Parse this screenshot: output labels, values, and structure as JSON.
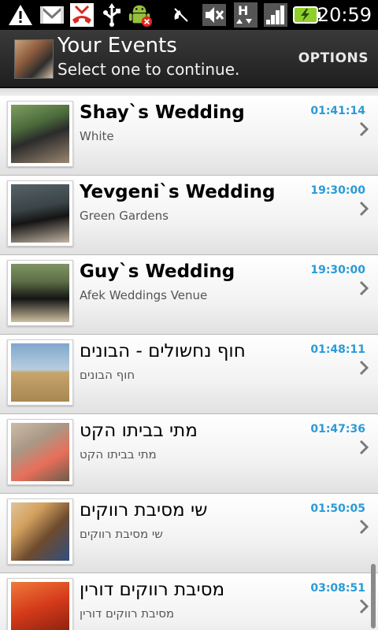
{
  "status_bar": {
    "time": "20:59",
    "icons": [
      "warning-icon",
      "gmail-icon",
      "missed-call-icon",
      "usb-icon",
      "android-debug-icon",
      "mute-icon",
      "speaker-mute-icon",
      "hspa-data-icon",
      "signal-icon",
      "battery-charging-icon"
    ]
  },
  "header": {
    "title": "Your Events",
    "subtitle": "Select one to continue.",
    "options_label": "OPTIONS"
  },
  "events": [
    {
      "title": "Shay`s Wedding",
      "location": "White",
      "time": "01:41:14",
      "bold": true,
      "thumb_colors": [
        "#6f8f5a",
        "#2a2a2a",
        "#9c8a72"
      ]
    },
    {
      "title": "Yevgeni`s Wedding",
      "location": "Green Gardens",
      "time": "19:30:00",
      "bold": true,
      "thumb_colors": [
        "#5e6b6e",
        "#1a1a1a",
        "#b7a89a"
      ]
    },
    {
      "title": "Guy`s Wedding",
      "location": "Afek Weddings Venue",
      "time": "19:30:00",
      "bold": true,
      "thumb_colors": [
        "#7b8e5e",
        "#121212",
        "#c7b79a"
      ]
    },
    {
      "title": "חוף נחשולים - הבונים",
      "location": "חוף הבונים",
      "time": "01:48:11",
      "bold": false,
      "thumb_colors": [
        "#8fb2cf",
        "#c7a56b",
        "#a88752"
      ]
    },
    {
      "title": "מתי בביתו הקט",
      "location": "מתי בביתו הקט",
      "time": "01:47:36",
      "bold": false,
      "thumb_colors": [
        "#c9b8a3",
        "#e86f5a",
        "#6b5c4c"
      ]
    },
    {
      "title": "שי מסיבת רווקים",
      "location": "שי מסיבת רווקים",
      "time": "01:50:05",
      "bold": false,
      "thumb_colors": [
        "#d3a15e",
        "#6e4b2e",
        "#2f4f7f"
      ]
    },
    {
      "title": "מסיבת רווקים דורין",
      "location": "מסיבת רווקים דורין",
      "time": "03:08:51",
      "bold": false,
      "thumb_colors": [
        "#d43a1a",
        "#f07a3a",
        "#7a1c0c"
      ]
    }
  ]
}
